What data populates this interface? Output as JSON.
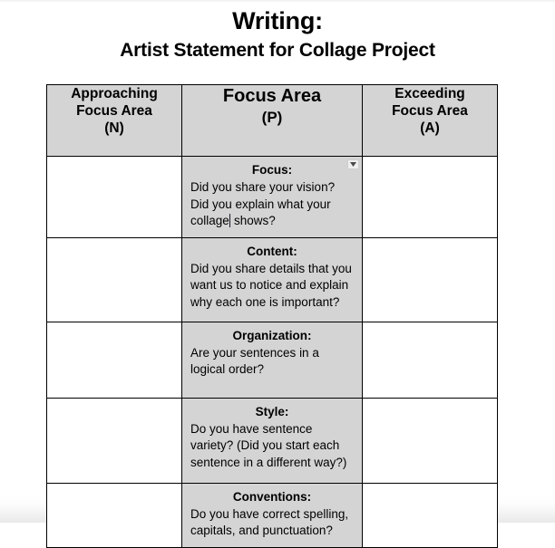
{
  "document": {
    "title_line1": "Writing:",
    "title_line2": "Artist Statement for Collage Project"
  },
  "table": {
    "headers": [
      {
        "line1": "Approaching",
        "line2": "Focus Area",
        "line3": "(N)"
      },
      {
        "line1": "Focus Area",
        "line2": "(P)",
        "line3": ""
      },
      {
        "line1": "Exceeding",
        "line2": "Focus Area",
        "line3": "(A)"
      }
    ],
    "rows": [
      {
        "approaching": "",
        "criteria_title": "Focus:",
        "criteria_body": "Did you share your vision? Did you explain what your collage",
        "criteria_body_after_caret": " shows?",
        "exceeding": ""
      },
      {
        "approaching": "",
        "criteria_title": "Content:",
        "criteria_body": "Did you share details that you want us to notice and explain why each one is important?",
        "exceeding": ""
      },
      {
        "approaching": "",
        "criteria_title": "Organization:",
        "criteria_body": "Are your sentences in a logical order?",
        "exceeding": ""
      },
      {
        "approaching": "",
        "criteria_title": "Style:",
        "criteria_body": "Do you have sentence variety? (Did you start each sentence in a different way?)",
        "exceeding": ""
      },
      {
        "approaching": "",
        "criteria_title": "Conventions:",
        "criteria_body": "Do you have correct spelling, capitals, and punctuation?",
        "exceeding": ""
      }
    ]
  },
  "widgets": {
    "cell_handle_icon": "chevron-down-icon"
  },
  "colors": {
    "cell_fill": "#d4d4d4",
    "border": "#000000",
    "page_background": "#ffffff",
    "text": "#000000"
  }
}
